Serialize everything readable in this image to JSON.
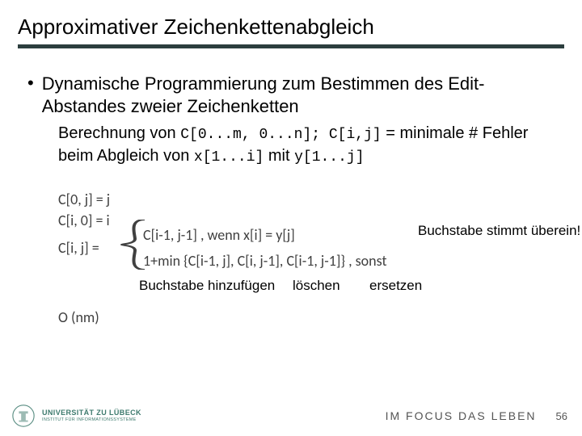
{
  "title": "Approximativer Zeichenkettenabgleich",
  "bullet": "Dynamische Programmierung zum Bestimmen des Edit-Abstandes zweier Zeichenketten",
  "sub": {
    "pre": "Berechnung von ",
    "code1": "C[0...m, 0...n]; C[i,j]",
    "mid": " = minimale # Fehler beim Abgleich von ",
    "code2": "x[1...i]",
    "mid2": " mit ",
    "code3": "y[1...j]"
  },
  "formulas": {
    "line0": "C[0, j] = j",
    "line1": "C[i, 0] = i",
    "line2_left": "C[i, j] = ",
    "case1": "C[i-1, j-1] ,  wenn x[i] = y[j]",
    "case2": "1+min {C[i-1, j], C[i, j-1], C[i-1, j-1]} , sonst",
    "complexity": "O (nm)"
  },
  "annotations": {
    "match": "Buchstabe stimmt überein!",
    "add": "Buchstabe hinzufügen",
    "del": "löschen",
    "rep": "ersetzen"
  },
  "footer": {
    "uni_line1": "UNIVERSITÄT ZU LÜBECK",
    "uni_line2": "INSTITUT FÜR INFORMATIONSSYSTEME",
    "motto": "IM FOCUS DAS LEBEN",
    "page": "56"
  }
}
